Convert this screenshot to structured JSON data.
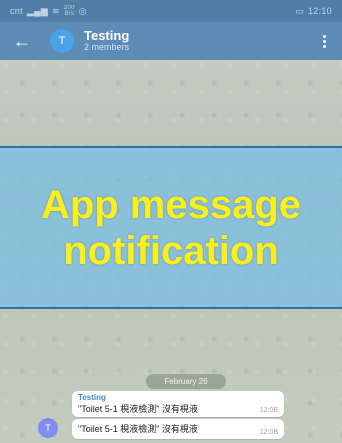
{
  "status_bar": {
    "carrier": "cnt",
    "speed_top": "200",
    "speed_unit": "B/s",
    "time": "12:10"
  },
  "app_bar": {
    "title": "Testing",
    "subtitle": "2 members",
    "avatar_letter": "T"
  },
  "banner": {
    "line1": "App message",
    "line2": "notification"
  },
  "date_label": "February 26",
  "messages": [
    {
      "sender": "Testing",
      "text": "\"Toilet 5-1 梘液檢測\" 沒有梘液",
      "time": "12:0B"
    },
    {
      "sender": "",
      "text": "\"Toilet 5-1 梘液檢測\" 沒有梘液",
      "time": "12:0B",
      "avatar_letter": "T"
    }
  ],
  "colors": {
    "app_bar": "#5d8db6",
    "banner_text": "#f8ef1c",
    "banner_bg": "#78bee6"
  }
}
